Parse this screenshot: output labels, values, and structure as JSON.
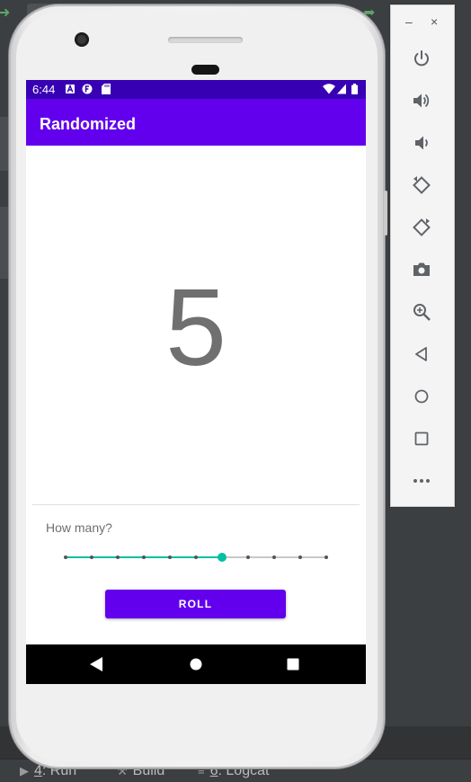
{
  "ide": {
    "bottom_tabs": [
      {
        "number": "4",
        "label": ": Run",
        "icon": "run-icon"
      },
      {
        "number": "",
        "label": "Build",
        "icon": "hammer-icon"
      },
      {
        "number": "6",
        "label": ": Logcat",
        "icon": "logcat-icon"
      }
    ]
  },
  "emulator": {
    "status_bar": {
      "time": "6:44",
      "icons_left": [
        "accessibility-a-icon",
        "dev-f-icon",
        "sd-card-icon"
      ],
      "icons_right": [
        "wifi-icon",
        "signal-icon",
        "battery-icon"
      ]
    },
    "window_controls": {
      "minimize": "–",
      "close": "×"
    },
    "toolbar_buttons": [
      "power-icon",
      "volume-up-icon",
      "volume-down-icon",
      "rotate-left-icon",
      "rotate-right-icon",
      "camera-icon",
      "zoom-icon",
      "back-icon",
      "home-icon",
      "overview-icon",
      "more-icon"
    ]
  },
  "app": {
    "title": "Randomized",
    "result": "5",
    "prompt": "How many?",
    "slider": {
      "min": 1,
      "max": 11,
      "value": 7,
      "accent": "#00bfa5"
    },
    "roll_label": "ROLL"
  },
  "colors": {
    "primary": "#6200ee",
    "primary_dark": "#3700b3",
    "accent": "#00bfa5"
  }
}
